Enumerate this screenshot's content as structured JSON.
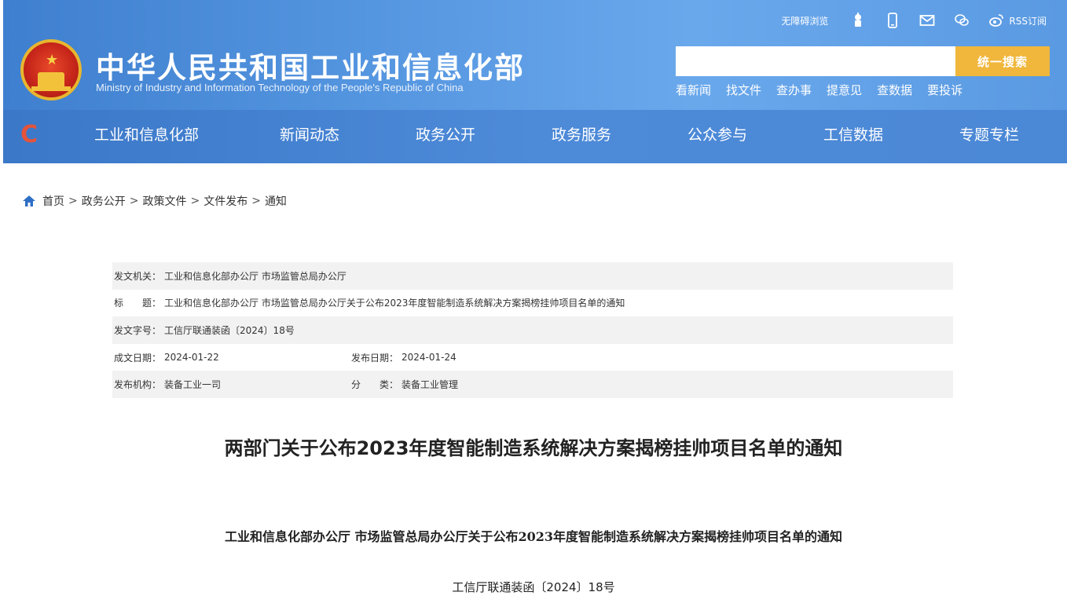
{
  "header": {
    "title": "中华人民共和国工业和信息化部",
    "subtitle": "Ministry of Industry and Information Technology of the People's Republic of China",
    "top_links": {
      "accessible": "无障碍浏览",
      "rss": "RSS订阅"
    },
    "top_icons": [
      "robot-icon",
      "mobile-icon",
      "mail-icon",
      "wechat-icon",
      "weibo-icon"
    ],
    "search": {
      "placeholder": "",
      "button": "统一搜索"
    },
    "quick_links": [
      "看新闻",
      "找文件",
      "查办事",
      "提意见",
      "查数据",
      "要投诉"
    ],
    "nav": [
      "工业和信息化部",
      "新闻动态",
      "政务公开",
      "政务服务",
      "公众参与",
      "工信数据",
      "专题专栏"
    ],
    "colors": {
      "header_blue": "#4d8ad8",
      "search_button": "#f0b73c"
    }
  },
  "breadcrumb": [
    "首页",
    "政务公开",
    "政策文件",
    "文件发布",
    "通知"
  ],
  "meta": {
    "issuer_label": "发文机关：",
    "issuer": "工业和信息化部办公厅 市场监管总局办公厅",
    "title_label": "标　　题：",
    "title": "工业和信息化部办公厅 市场监管总局办公厅关于公布2023年度智能制造系统解决方案揭榜挂帅项目名单的通知",
    "docno_label": "发文字号：",
    "docno": "工信厅联通装函〔2024〕18号",
    "written_label": "成文日期：",
    "written": "2024-01-22",
    "published_label": "发布日期：",
    "published": "2024-01-24",
    "org_label": "发布机构：",
    "org": "装备工业一司",
    "category_label": "分　　类：",
    "category": "装备工业管理"
  },
  "article": {
    "title": "两部门关于公布2023年度智能制造系统解决方案揭榜挂帅项目名单的通知",
    "subtitle": "工业和信息化部办公厅 市场监管总局办公厅关于公布2023年度智能制造系统解决方案揭榜挂帅项目名单的通知",
    "docno": "工信厅联通装函〔2024〕18号"
  }
}
